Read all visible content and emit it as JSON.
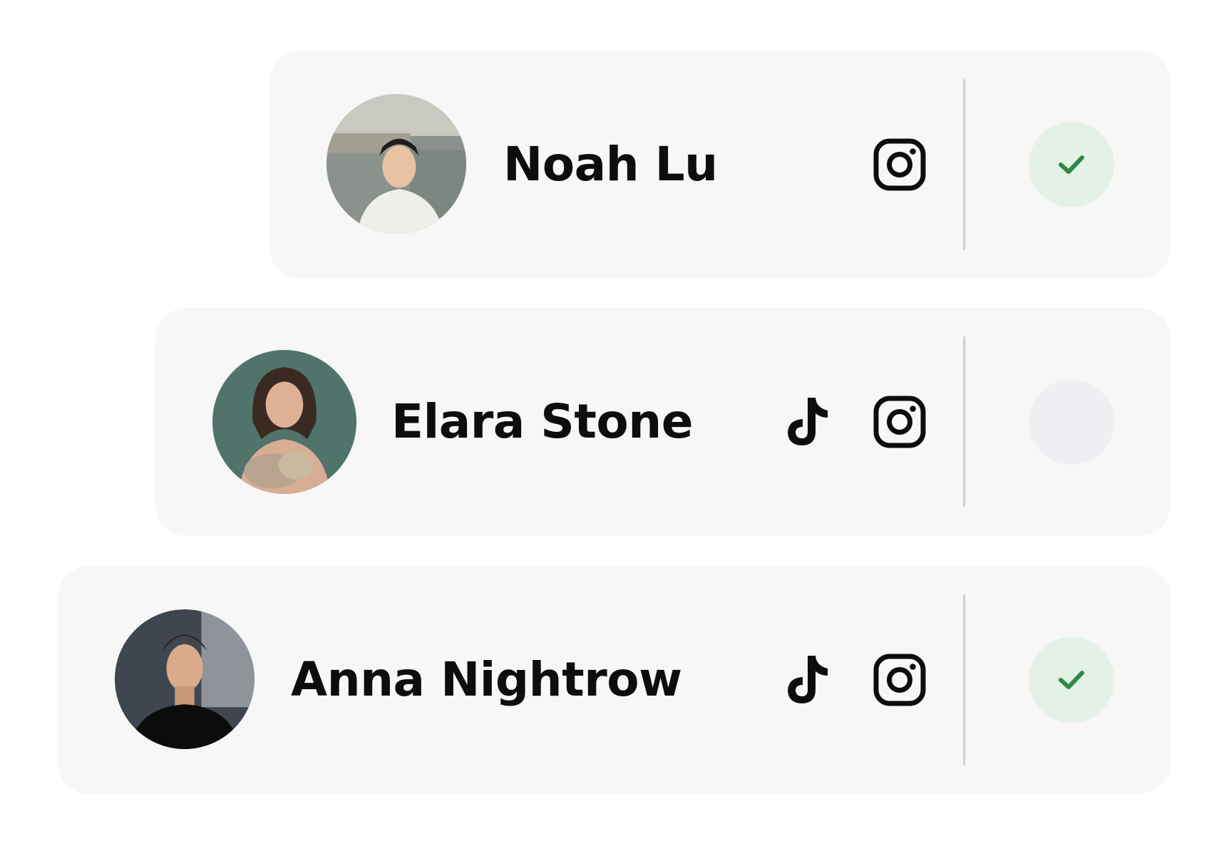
{
  "colors": {
    "card_background": "#f7f7f7",
    "name_text": "#0d0d0d",
    "check_green": "#2e8b45",
    "checked_bg": "#e4f1e6",
    "unchecked_bg": "#efeff3",
    "divider": "#cfcfcf"
  },
  "creators": [
    {
      "name": "Noah Lu",
      "avatar": "avatar-photo",
      "platforms": [
        "instagram-icon"
      ],
      "selected": true
    },
    {
      "name": "Elara Stone",
      "avatar": "avatar-photo",
      "platforms": [
        "tiktok-icon",
        "instagram-icon"
      ],
      "selected": false
    },
    {
      "name": "Anna Nightrow",
      "avatar": "avatar-photo",
      "platforms": [
        "tiktok-icon",
        "instagram-icon"
      ],
      "selected": true
    }
  ]
}
